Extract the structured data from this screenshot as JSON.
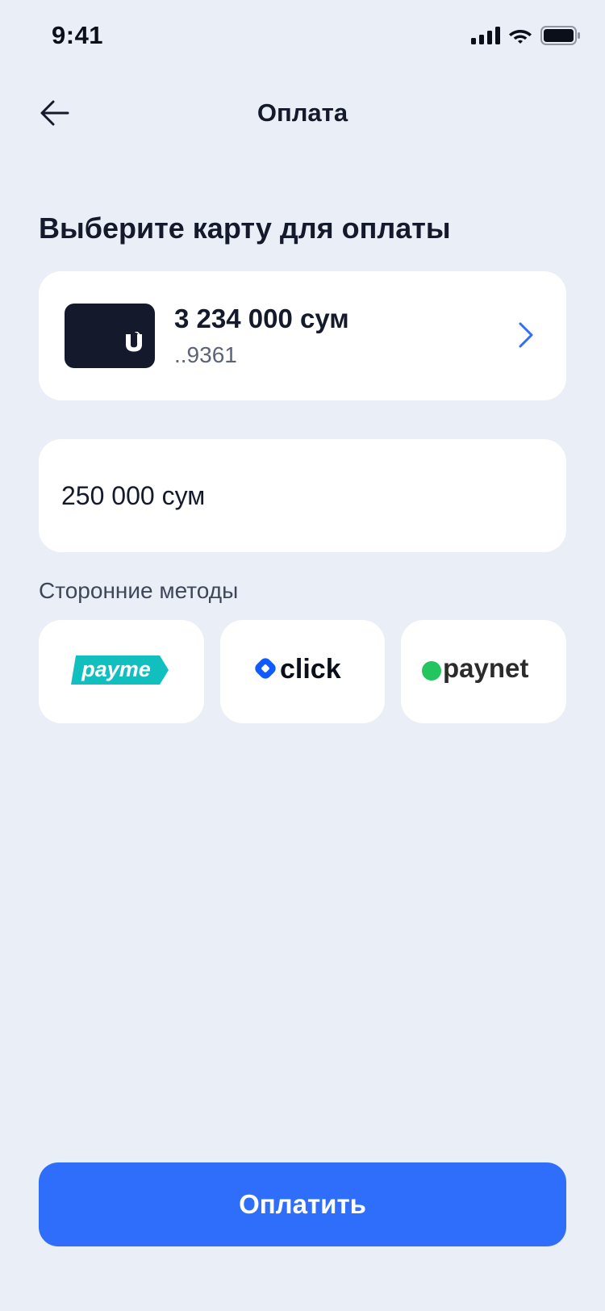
{
  "status_bar": {
    "time": "9:41",
    "icons": [
      "signal-icon",
      "wifi-icon",
      "battery-icon"
    ]
  },
  "header": {
    "title": "Оплата",
    "back_icon": "arrow-left-icon"
  },
  "section_title": "Выберите карту для оплаты",
  "selected_card": {
    "balance": "3 234 000 сум",
    "number": "..9361",
    "icon": "chevron-right-icon"
  },
  "amount_input": {
    "value": "250 000 сум"
  },
  "third_party": {
    "label": "Сторонние методы",
    "methods": [
      {
        "name": "payme",
        "color": "#12BFBF"
      },
      {
        "name": "click",
        "color": "#0F5BFF"
      },
      {
        "name": "paynet",
        "color": "#22C55E"
      }
    ]
  },
  "pay_button": {
    "label": "Оплатить"
  },
  "colors": {
    "background": "#EAEFF7",
    "accent": "#2F6EFB",
    "card_dark": "#141A2B"
  }
}
